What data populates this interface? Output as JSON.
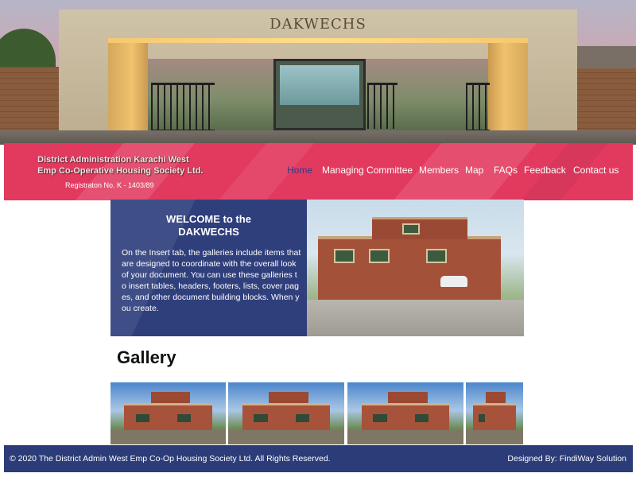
{
  "hero": {
    "gate_sign": "DAKWECHS",
    "image": "gate-photo"
  },
  "header": {
    "org_line1": "District Administration Karachi West",
    "org_line2": "Emp Co-Operative Housing Society Ltd.",
    "registration": "Registraton No. K - 1403/89",
    "banner_color": "#e23a5f"
  },
  "nav": {
    "items": [
      {
        "label": "Home",
        "active": true
      },
      {
        "label": "Managing Committee",
        "active": false
      },
      {
        "label": "Members",
        "active": false
      },
      {
        "label": "Map",
        "active": false
      },
      {
        "label": "FAQs",
        "active": false
      },
      {
        "label": "Feedback",
        "active": false
      },
      {
        "label": "Contact us",
        "active": false
      }
    ],
    "active_color": "#2e3a8c"
  },
  "welcome": {
    "title_line1": "WELCOME to the",
    "title_line2": "DAKWECHS",
    "body": "On the Insert tab, the galleries include items that are designed to coordinate with the overall look of your document. You can use these galleries to insert tables, headers, footers, lists, cover pages, and other document building blocks. When you create.",
    "panel_color": "#2f3f7c"
  },
  "gallery": {
    "title": "Gallery",
    "images": [
      "house-thumb-1",
      "house-thumb-2",
      "house-thumb-3",
      "house-thumb-4"
    ]
  },
  "footer": {
    "copyright": "© 2020 The District Admin West Emp Co-Op Housing Society Ltd. All Rights Reserved.",
    "credit": "Designed By: FindiWay Solution",
    "color": "#2c3c78"
  }
}
